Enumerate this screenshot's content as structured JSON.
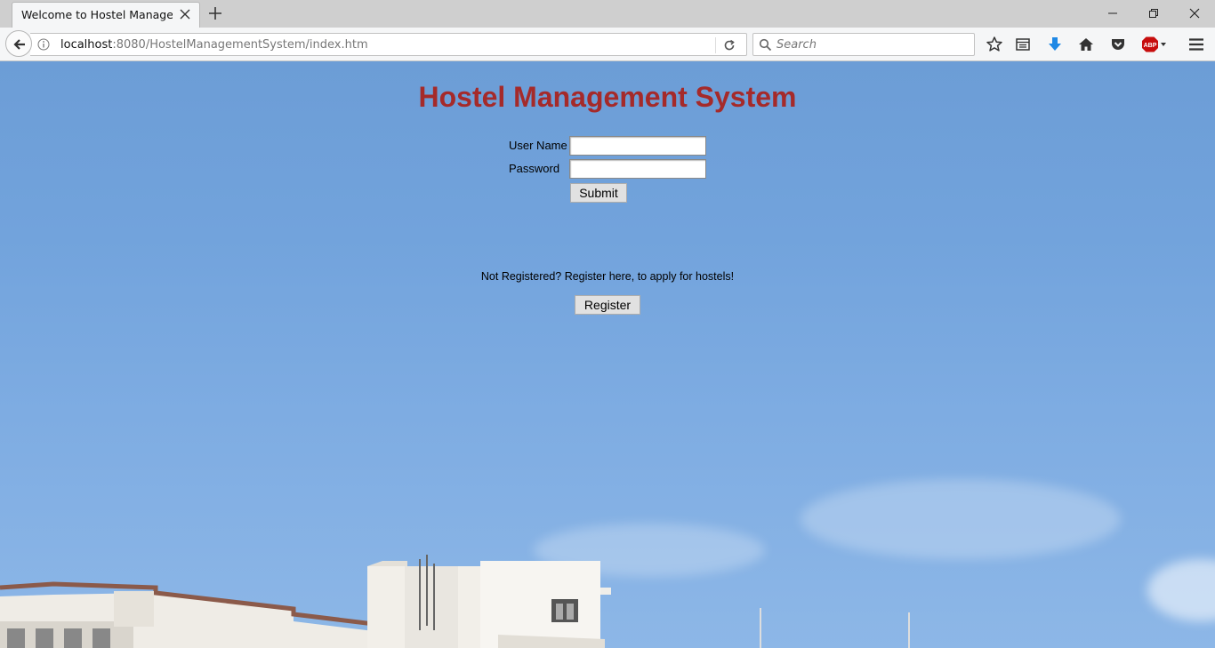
{
  "browser": {
    "tab_title": "Welcome to Hostel Managem...",
    "url_host": "localhost",
    "url_rest": ":8080/HostelManagementSystem/index.htm",
    "search_placeholder": "Search",
    "adblock_label": "ABP"
  },
  "page": {
    "heading": "Hostel Management System",
    "username_label": "User Name",
    "password_label": "Password",
    "username_value": "",
    "password_value": "",
    "submit_label": "Submit",
    "register_note": "Not Registered? Register here, to apply for hostels!",
    "register_label": "Register"
  },
  "colors": {
    "heading": "#a52a2a",
    "sky": "#72a3dc"
  }
}
